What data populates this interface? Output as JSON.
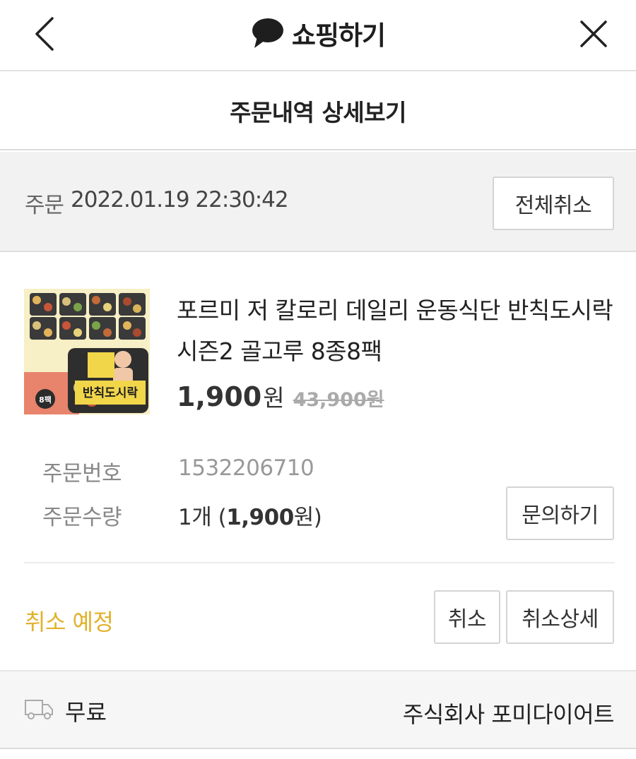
{
  "header": {
    "title": "쇼핑하기",
    "back_icon": "chevron-left-icon",
    "close_icon": "close-icon",
    "brand_icon": "speech-bubble-icon"
  },
  "subheader": {
    "title": "주문내역 상세보기"
  },
  "order": {
    "date_label": "주문",
    "date_value": "2022.01.19 22:30:42",
    "cancel_all_label": "전체취소"
  },
  "product": {
    "image_badge": "8팩",
    "image_caption": "반칙도시락",
    "title": "포르미 저 칼로리 데일리 운동식단 반칙도시락 시즌2 골고루 8종8팩",
    "price": "1,900",
    "price_unit": "원",
    "original_price": "43,900원"
  },
  "details": {
    "order_number_label": "주문번호",
    "order_number_value": "1532206710",
    "quantity_label": "주문수량",
    "quantity_prefix": "1개 (",
    "quantity_amount": "1,900",
    "quantity_suffix": "원)",
    "inquiry_label": "문의하기"
  },
  "status": {
    "text": "취소 예정",
    "color": "#e2b12c",
    "cancel_label": "취소",
    "cancel_detail_label": "취소상세"
  },
  "shipping": {
    "icon": "truck-icon",
    "fee": "무료",
    "seller": "주식회사 포미다이어트"
  }
}
